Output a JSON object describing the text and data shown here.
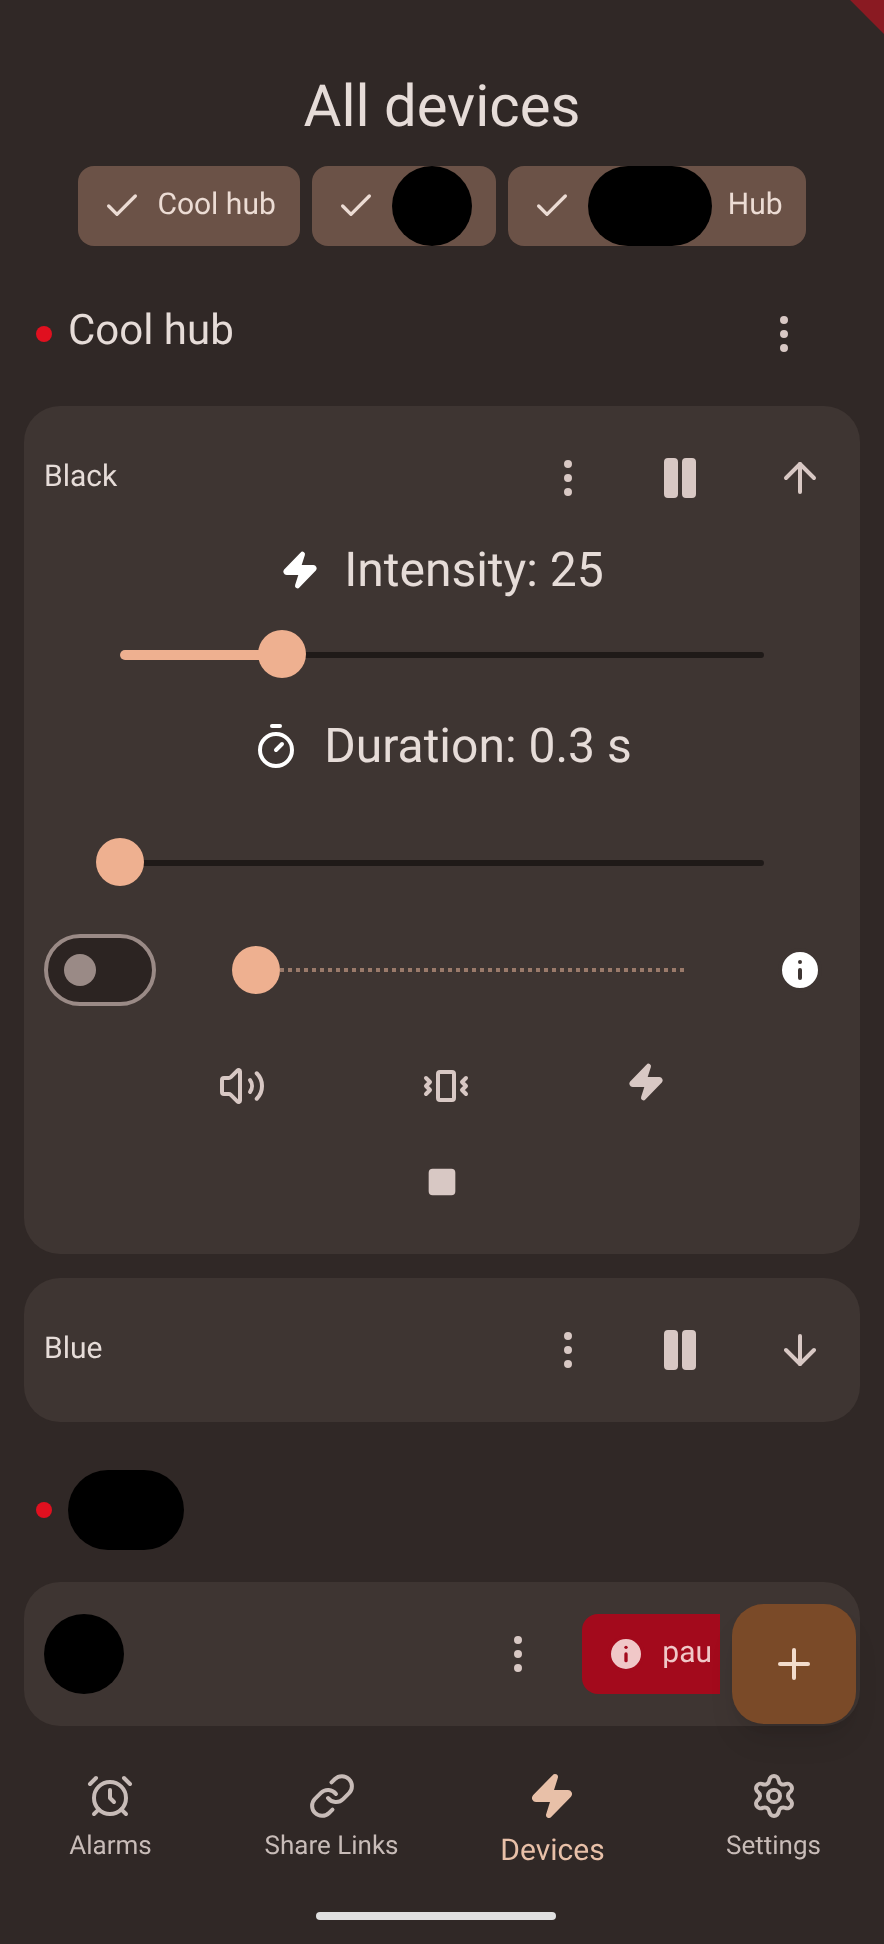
{
  "title": "All devices",
  "filters": [
    {
      "label": "Cool hub",
      "checked": true,
      "redacted": false
    },
    {
      "checked": true,
      "redacted": true
    },
    {
      "label": "Hub",
      "checked": true,
      "redacted": true
    }
  ],
  "hubs": [
    {
      "name": "Cool hub",
      "color": "#e0101f",
      "devices": [
        {
          "kind": "expanded",
          "name": "Black",
          "intensity": {
            "label": "Intensity: 25",
            "level": 0.25
          },
          "duration": {
            "label": "Duration: 0.3 s",
            "level": 0
          },
          "pattern": {
            "on": false,
            "level": 0
          }
        },
        {
          "kind": "collapsed",
          "name": "Blue"
        }
      ]
    },
    {
      "color": "#e0101f",
      "devices": [
        {
          "kind": "alert",
          "badge": "pau"
        }
      ]
    }
  ],
  "nav": [
    {
      "label": "Alarms",
      "selected": false
    },
    {
      "label": "Share Links",
      "selected": false
    },
    {
      "label": "Devices",
      "selected": true
    },
    {
      "label": "Settings",
      "selected": false
    }
  ]
}
